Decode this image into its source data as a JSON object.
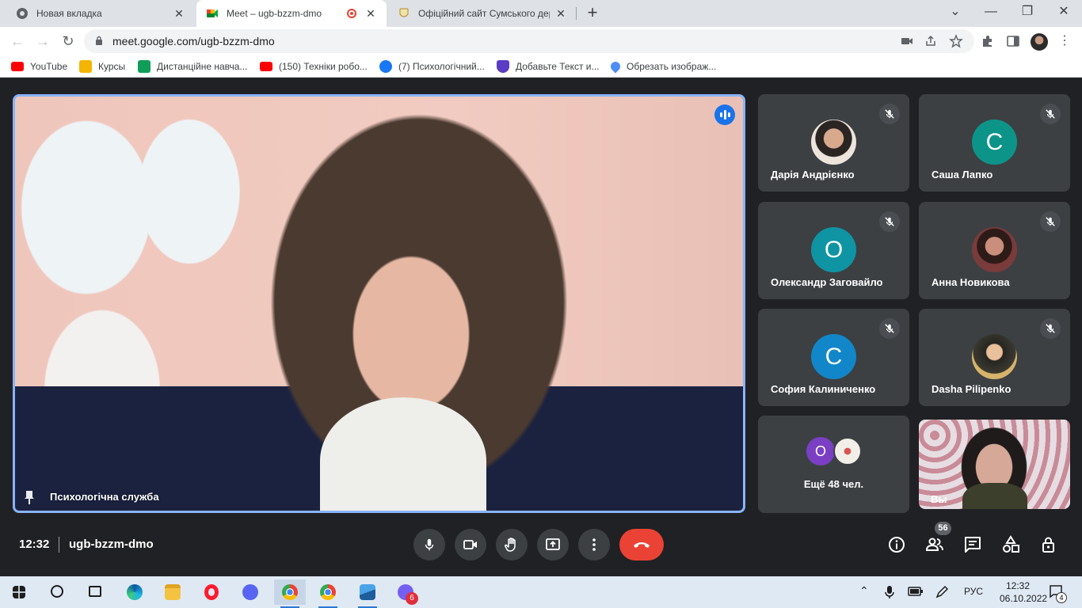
{
  "browser": {
    "tabs": [
      {
        "title": "Новая вкладка",
        "close": "✕",
        "favicon_color": "#5f6368"
      },
      {
        "title": "Meet – ugb-bzzm-dmo",
        "close": "✕",
        "favicon_color": "#00832d",
        "recording_dot_color": "#ea4335"
      },
      {
        "title": "Офіційний сайт Сумського держ",
        "close": "✕",
        "favicon_color": "#d4a017"
      }
    ],
    "new_tab": "+",
    "window_controls": {
      "tab_search": "⌄",
      "minimize": "—",
      "maximize": "❐",
      "close": "✕"
    },
    "nav": {
      "back": "←",
      "forward": "→",
      "reload": "↻"
    },
    "url": "meet.google.com/ugb-bzzm-dmo",
    "bookmarks": [
      {
        "label": "YouTube",
        "icon": "youtube-icon",
        "color": "#ff0000"
      },
      {
        "label": "Курсы",
        "icon": "classroom-icon",
        "color": "#f4b400"
      },
      {
        "label": "Дистанційне навча...",
        "icon": "classroom-green-icon",
        "color": "#0f9d58"
      },
      {
        "label": "(150) Техніки робо...",
        "icon": "youtube-icon",
        "color": "#ff0000"
      },
      {
        "label": "(7) Психологічний...",
        "icon": "facebook-icon",
        "color": "#1877f2"
      },
      {
        "label": "Добавьте Текст и...",
        "icon": "shield-icon",
        "color": "#5b3cc4"
      },
      {
        "label": "Обрезать изображ...",
        "icon": "heart-icon",
        "color": "#4e8df5"
      }
    ]
  },
  "meet": {
    "main": {
      "name": "Психологічна служба"
    },
    "participants": [
      {
        "name": "Дарія Андрієнко",
        "initial": "",
        "avatar_type": "photo",
        "color": "#8d6e63"
      },
      {
        "name": "Саша Лапко",
        "initial": "С",
        "avatar_type": "letter",
        "color": "#0d9488"
      },
      {
        "name": "Олександр Заговайло",
        "initial": "О",
        "avatar_type": "letter",
        "color": "#0e94a3"
      },
      {
        "name": "Анна Новикова",
        "initial": "",
        "avatar_type": "photo",
        "color": "#7a3b3b"
      },
      {
        "name": "София Калиниченко",
        "initial": "С",
        "avatar_type": "letter",
        "color": "#1187c9"
      },
      {
        "name": "Dasha Pilipenko",
        "initial": "",
        "avatar_type": "photo",
        "color": "#5a5448"
      }
    ],
    "more": {
      "label": "Ещё 48 чел.",
      "initial": "О",
      "color": "#7b3fc4"
    },
    "self": {
      "name": "Вы"
    },
    "time": "12:32",
    "code": "ugb-bzzm-dmo",
    "participant_count": "56"
  },
  "taskbar": {
    "lang": "РУС",
    "time": "12:32",
    "date": "06.10.2022",
    "notifications": "4",
    "viber_badge": "6"
  }
}
